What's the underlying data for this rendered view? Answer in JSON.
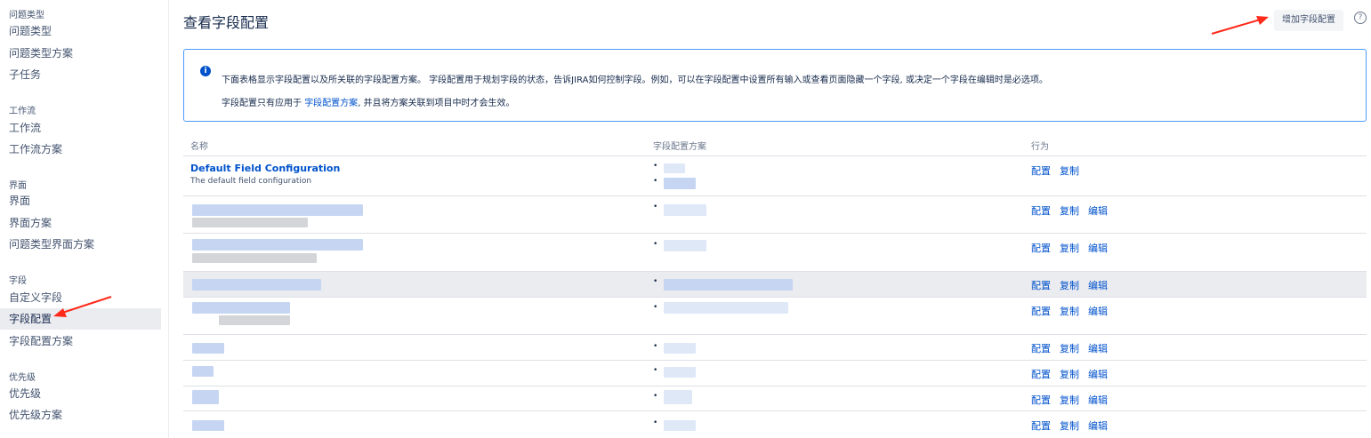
{
  "sidebar": {
    "groups": [
      {
        "title": "问题类型",
        "items": [
          "问题类型",
          "问题类型方案",
          "子任务"
        ]
      },
      {
        "title": "工作流",
        "items": [
          "工作流",
          "工作流方案"
        ]
      },
      {
        "title": "界面",
        "items": [
          "界面",
          "界面方案",
          "问题类型界面方案"
        ]
      },
      {
        "title": "字段",
        "items": [
          "自定义字段",
          "字段配置",
          "字段配置方案"
        ]
      },
      {
        "title": "优先级",
        "items": [
          "优先级",
          "优先级方案"
        ]
      }
    ],
    "active_item": "字段配置"
  },
  "header": {
    "title": "查看字段配置",
    "add_button": "增加字段配置",
    "help_icon": "help-icon"
  },
  "info": {
    "icon": "info-icon",
    "line1": "下面表格显示字段配置以及所关联的字段配置方案。 字段配置用于规划字段的状态，告诉JIRA如何控制字段。例如，可以在字段配置中设置所有输入或查看页面隐藏一个字段, 或决定一个字段在编辑时是必选项。",
    "line2_prefix": "字段配置只有应用于 ",
    "line2_link": "字段配置方案",
    "line2_suffix": ", 并且将方案关联到项目中时才会生效。"
  },
  "table": {
    "headers": [
      "名称",
      "字段配置方案",
      "行为"
    ],
    "rows": [
      {
        "name": "Default Field Configuration",
        "description": "The default field configuration",
        "actions": [
          "配置",
          "复制"
        ]
      },
      {
        "name": "",
        "description": "",
        "actions": [
          "配置",
          "复制",
          "编辑"
        ]
      },
      {
        "name": "",
        "description": "",
        "actions": [
          "配置",
          "复制",
          "编辑"
        ]
      },
      {
        "name": "",
        "description": "",
        "actions": [
          "配置",
          "复制",
          "编辑"
        ]
      },
      {
        "name": "",
        "description": "",
        "actions": [
          "配置",
          "复制",
          "编辑"
        ]
      },
      {
        "name": "",
        "description": "",
        "actions": [
          "配置",
          "复制",
          "编辑"
        ]
      },
      {
        "name": "",
        "description": "",
        "actions": [
          "配置",
          "复制",
          "编辑"
        ]
      },
      {
        "name": "",
        "description": "",
        "actions": [
          "配置",
          "复制",
          "编辑"
        ]
      },
      {
        "name": "",
        "description": "",
        "actions": [
          "配置",
          "复制",
          "编辑"
        ]
      }
    ]
  },
  "colors": {
    "link": "#0052cc",
    "annotation_arrow": "#ff2a1a",
    "info_border": "#4c9aff"
  }
}
